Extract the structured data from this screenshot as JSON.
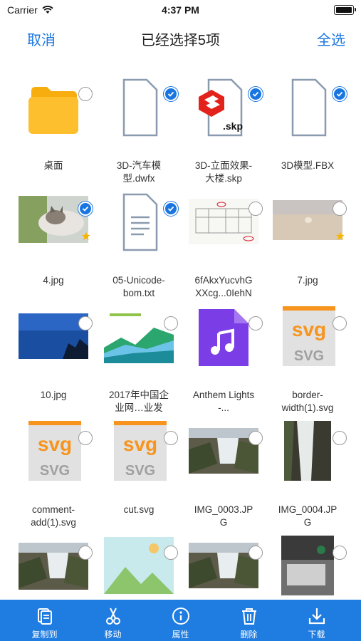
{
  "status_bar": {
    "carrier": "Carrier",
    "time": "4:37 PM"
  },
  "nav": {
    "cancel": "取消",
    "title": "已经选择5项",
    "select_all": "全选"
  },
  "files": [
    {
      "name": "桌面",
      "type": "folder",
      "checked": false,
      "starred": false
    },
    {
      "name": "3D-汽车模\n型.dwfx",
      "type": "doc",
      "checked": true,
      "starred": false
    },
    {
      "name": "3D-立面效果-\n大楼.skp",
      "type": "skp",
      "checked": true,
      "starred": false,
      "badge": ".skp"
    },
    {
      "name": "3D模型.FBX",
      "type": "doc",
      "checked": true,
      "starred": false
    },
    {
      "name": "4.jpg",
      "type": "photo-cat",
      "checked": true,
      "starred": true
    },
    {
      "name": "05-Unicode-\nbom.txt",
      "type": "txt",
      "checked": true,
      "starred": false
    },
    {
      "name": "6fAkxYucvhG\nXXcg...0IehN",
      "type": "photo-drawing",
      "checked": false,
      "starred": false
    },
    {
      "name": "7.jpg",
      "type": "photo-beach",
      "checked": false,
      "starred": true
    },
    {
      "name": "10.jpg",
      "type": "photo-sky",
      "checked": false,
      "starred": false
    },
    {
      "name": "2017年中国企\n业网…业发",
      "type": "photo-chart",
      "checked": false,
      "starred": false
    },
    {
      "name": "Anthem Lights\n-...",
      "type": "music",
      "checked": false,
      "starred": false
    },
    {
      "name": "border-\nwidth(1).svg",
      "type": "svg",
      "checked": false,
      "starred": false,
      "badge_top": "svg",
      "badge_bottom": "SVG"
    },
    {
      "name": "comment-\nadd(1).svg",
      "type": "svg",
      "checked": false,
      "starred": false,
      "badge_top": "svg",
      "badge_bottom": "SVG"
    },
    {
      "name": "cut.svg",
      "type": "svg",
      "checked": false,
      "starred": false,
      "badge_top": "svg",
      "badge_bottom": "SVG"
    },
    {
      "name": "IMG_0003.JP\nG",
      "type": "photo-falls",
      "checked": false,
      "starred": false
    },
    {
      "name": "IMG_0004.JP\nG",
      "type": "photo-falls2",
      "checked": false,
      "starred": false
    },
    {
      "name": "",
      "type": "photo-falls3",
      "checked": false,
      "starred": false
    },
    {
      "name": "",
      "type": "image-placeholder",
      "checked": false,
      "starred": false
    },
    {
      "name": "",
      "type": "photo-falls",
      "checked": false,
      "starred": false
    },
    {
      "name": "",
      "type": "photo-desk",
      "checked": false,
      "starred": false
    }
  ],
  "toolbar": [
    {
      "label": "复制到",
      "icon": "copy-to-icon"
    },
    {
      "label": "移动",
      "icon": "scissors-icon"
    },
    {
      "label": "属性",
      "icon": "info-icon"
    },
    {
      "label": "删除",
      "icon": "trash-icon"
    },
    {
      "label": "下载",
      "icon": "download-icon"
    }
  ],
  "colors": {
    "accent": "#1976e0",
    "toolbar": "#1f7ce0",
    "folder": "#fdbf2d",
    "star": "#f5b400"
  }
}
